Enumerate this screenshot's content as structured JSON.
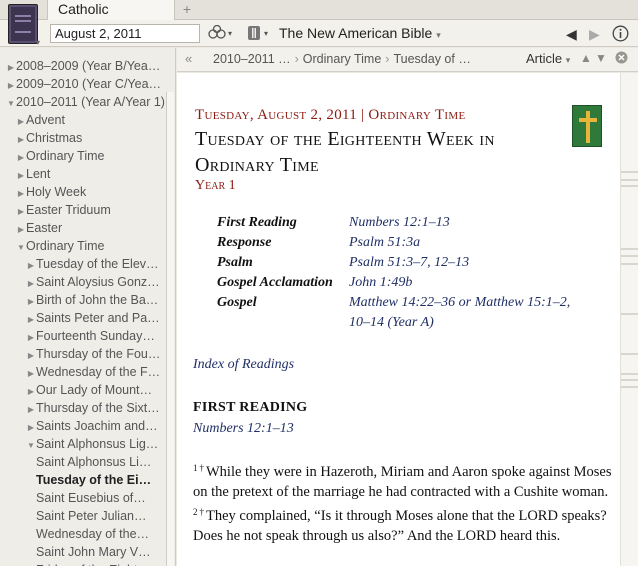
{
  "window": {
    "tab_label": "Catholic Lectionary",
    "tab_add": "+"
  },
  "toolbar": {
    "date_value": "August 2, 2011",
    "bible_title": "The New American Bible"
  },
  "sidebar": {
    "items": [
      {
        "label": "2008–2009 (Year B/Yea…",
        "level": 0,
        "expanded": false
      },
      {
        "label": "2009–2010 (Year C/Yea…",
        "level": 0,
        "expanded": false
      },
      {
        "label": "2010–2011 (Year A/Year 1)",
        "level": 0,
        "expanded": true
      },
      {
        "label": "Advent",
        "level": 1,
        "expanded": false
      },
      {
        "label": "Christmas",
        "level": 1,
        "expanded": false
      },
      {
        "label": "Ordinary Time",
        "level": 1,
        "expanded": false
      },
      {
        "label": "Lent",
        "level": 1,
        "expanded": false
      },
      {
        "label": "Holy Week",
        "level": 1,
        "expanded": false
      },
      {
        "label": "Easter Triduum",
        "level": 1,
        "expanded": false
      },
      {
        "label": "Easter",
        "level": 1,
        "expanded": false
      },
      {
        "label": "Ordinary Time",
        "level": 1,
        "expanded": true
      },
      {
        "label": "Tuesday of the Elev…",
        "level": 2,
        "expanded": false
      },
      {
        "label": "Saint Aloysius Gonz…",
        "level": 2,
        "expanded": false
      },
      {
        "label": "Birth of John the Ba…",
        "level": 2,
        "expanded": false
      },
      {
        "label": "Saints Peter and Pa…",
        "level": 2,
        "expanded": false
      },
      {
        "label": "Fourteenth Sunday…",
        "level": 2,
        "expanded": false
      },
      {
        "label": "Thursday of the Fou…",
        "level": 2,
        "expanded": false
      },
      {
        "label": "Wednesday of the F…",
        "level": 2,
        "expanded": false
      },
      {
        "label": "Our Lady of Mount…",
        "level": 2,
        "expanded": false
      },
      {
        "label": "Thursday of the Sixt…",
        "level": 2,
        "expanded": false
      },
      {
        "label": "Saints Joachim and…",
        "level": 2,
        "expanded": false
      },
      {
        "label": "Saint Alphonsus Lig…",
        "level": 2,
        "expanded": true
      },
      {
        "label": "Saint Alphonsus Li…",
        "level": 3,
        "leaf": true
      },
      {
        "label": "Tuesday of the Ei…",
        "level": 3,
        "leaf": true,
        "selected": true
      },
      {
        "label": "Saint Eusebius of…",
        "level": 3,
        "leaf": true
      },
      {
        "label": "Saint Peter Julian…",
        "level": 3,
        "leaf": true
      },
      {
        "label": "Wednesday of the…",
        "level": 3,
        "leaf": true
      },
      {
        "label": "Saint John Mary V…",
        "level": 3,
        "leaf": true
      },
      {
        "label": "Friday of the Eight…",
        "level": 3,
        "leaf": true
      }
    ]
  },
  "content_header": {
    "breadcrumb": [
      "2010–2011 …",
      "Ordinary Time",
      "Tuesday of …"
    ],
    "article_label": "Article"
  },
  "article": {
    "dateline": "Tuesday, August 2, 2011 | Ordinary Time",
    "title": "Tuesday of the Eighteenth Week in Ordinary Time",
    "year": "Year 1",
    "readings": [
      {
        "label": "First Reading",
        "ref": "Numbers 12:1–13"
      },
      {
        "label": "Response",
        "ref": "Psalm 51:3a"
      },
      {
        "label": "Psalm",
        "ref": "Psalm 51:3–7, 12–13"
      },
      {
        "label": "Gospel Acclamation",
        "ref": "John 1:49b"
      },
      {
        "label": "Gospel",
        "ref": "Matthew 14:22–36 or Matthew 15:1–2, 10–14 (Year A)"
      }
    ],
    "index_link": "Index of Readings",
    "section_title": "FIRST READING",
    "section_ref": "Numbers 12:1–13",
    "verses": [
      {
        "num": "1",
        "mark": "†",
        "text": "While they were in Hazeroth, Miriam and Aaron spoke against Moses on the pretext of the marriage he had contracted with a Cushite woman."
      },
      {
        "num": "2",
        "mark": "†",
        "text": "They complained, “Is it through Moses alone that the LORD speaks? Does he not speak through us also?” And the LORD heard this."
      }
    ]
  },
  "colors": {
    "accent_red": "#8b1a12",
    "link_blue": "#1f2f66",
    "cross_green": "#2f7a3a",
    "cross_gold": "#e6b53a"
  }
}
